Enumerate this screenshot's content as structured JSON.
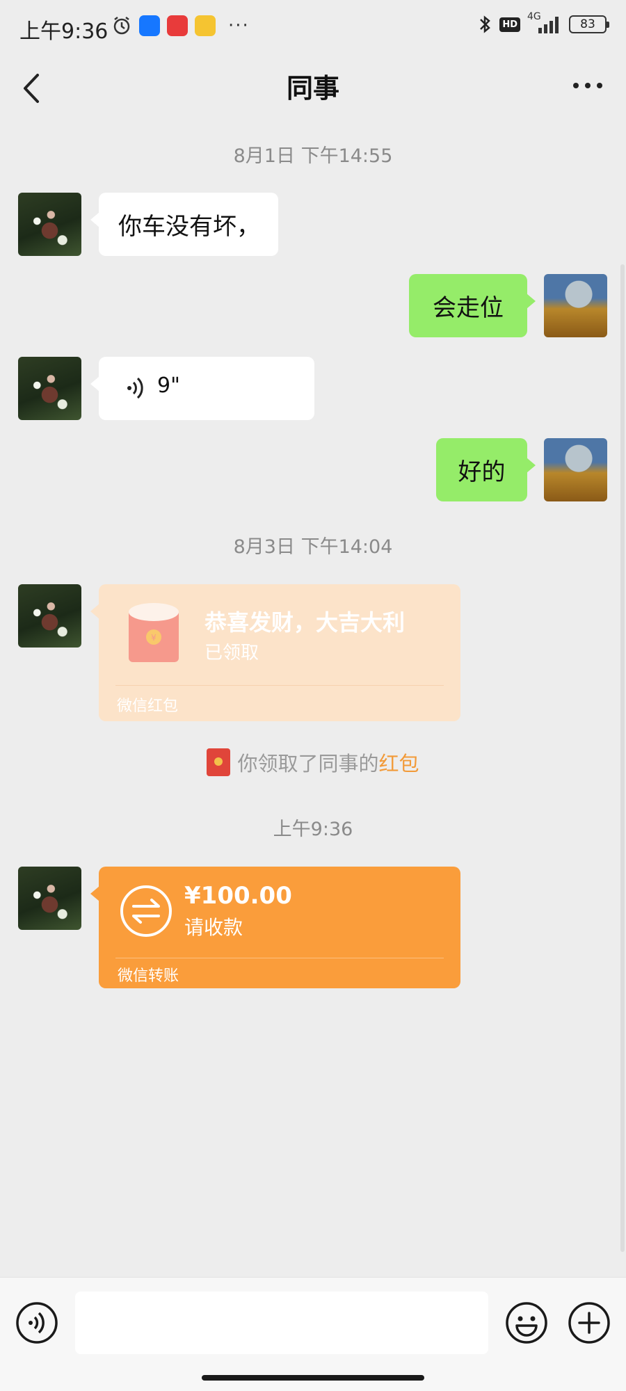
{
  "status_bar": {
    "time": "上午9:36",
    "network": "4G",
    "hd": "HD",
    "battery": "83",
    "more": "···"
  },
  "header": {
    "title": "同事"
  },
  "messages": {
    "ts1": "8月1日 下午14:55",
    "m1": "你车没有坏，",
    "m2": "会走位",
    "voice_duration": "9\"",
    "m4": "好的",
    "ts2": "8月3日 下午14:04",
    "red_packet": {
      "title": "恭喜发财，大吉大利",
      "status": "已领取",
      "footer": "微信红包"
    },
    "system_note": {
      "prefix": "你领取了同事的",
      "highlight": "红包"
    },
    "ts3": "上午9:36",
    "transfer": {
      "amount": "¥100.00",
      "action": "请收款",
      "footer": "微信转账"
    }
  },
  "icons": {
    "back": "chevron-left-icon",
    "more": "more-dots-icon",
    "voice": "voice-wave-icon",
    "emoji": "smile-icon",
    "plus": "plus-circle-icon",
    "transfer": "transfer-arrows-icon"
  },
  "colors": {
    "background": "#ededed",
    "self_bubble": "#95ec69",
    "other_bubble": "#ffffff",
    "red_packet_opened": "#fce3c9",
    "transfer": "#fa9d3b",
    "highlight": "#f29a38"
  }
}
